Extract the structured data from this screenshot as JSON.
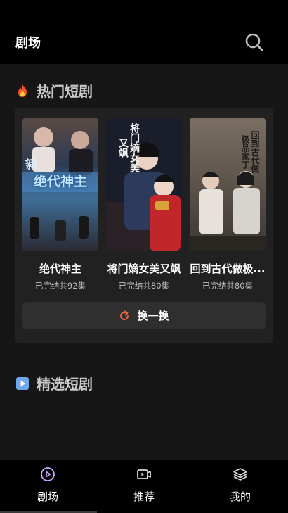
{
  "header": {
    "title": "剧场",
    "search_icon": "search-icon"
  },
  "hot_section": {
    "title": "热门短剧",
    "icon": "fire-icon"
  },
  "dramas": [
    {
      "title": "绝代神主",
      "episodes": "已完结共92集",
      "poster_text": "绝代神主",
      "poster_text_top": "新"
    },
    {
      "title": "将门嫡女美又飒",
      "episodes": "已完结共80集",
      "poster_text": "将门嫡女美又飒"
    },
    {
      "title": "回到古代做极...",
      "episodes": "已完结共80集",
      "poster_text": "回到古代做极品家丁"
    }
  ],
  "refresh_button": {
    "label": "换一换",
    "icon": "refresh-icon",
    "icon_color": "#e8643c"
  },
  "featured_section": {
    "title": "精选短剧",
    "icon": "play-square-icon"
  },
  "tabbar": {
    "tabs": [
      {
        "label": "剧场",
        "icon": "play-circle-icon",
        "active": true
      },
      {
        "label": "推荐",
        "icon": "video-icon",
        "active": false
      },
      {
        "label": "我的",
        "icon": "layers-icon",
        "active": false
      }
    ]
  },
  "colors": {
    "accent": "#e8643c",
    "background": "#161616",
    "panel": "#212121",
    "header": "#000000"
  }
}
